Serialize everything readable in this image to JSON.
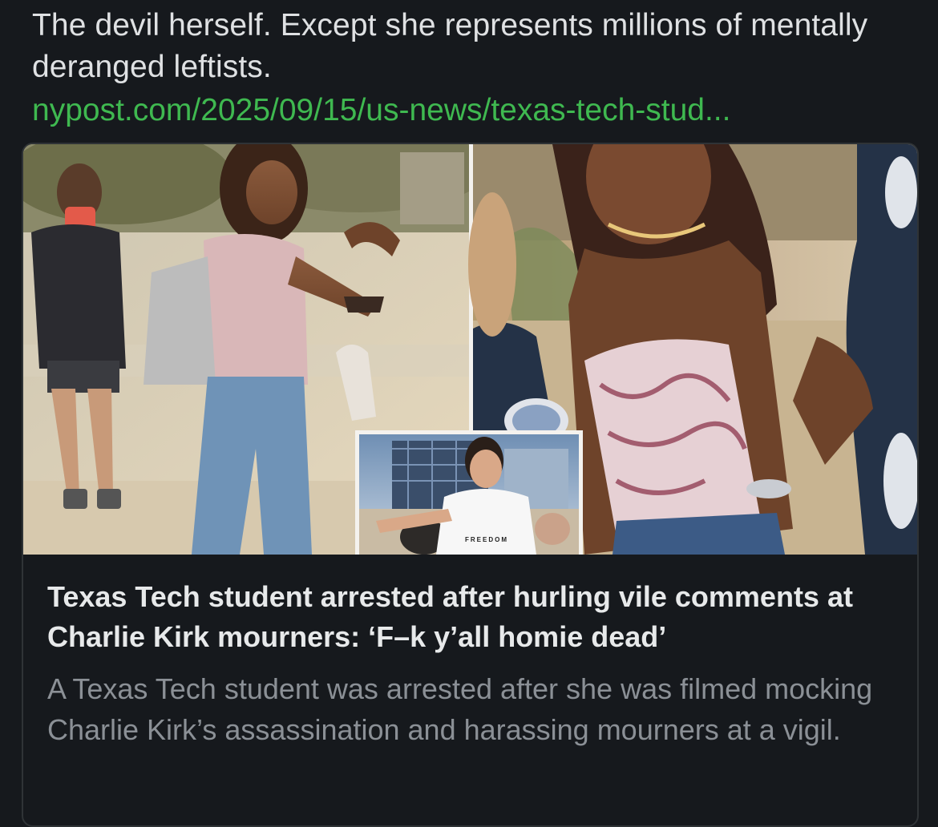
{
  "post": {
    "text": "The devil herself. Except she represents millions of mentally deranged leftists.",
    "link_text": "nypost.com/2025/09/15/us-news/texas-tech-stud..."
  },
  "link_card": {
    "image_caption_shirt": "FREEDOM",
    "title": "Texas Tech student arrested after hurling vile comments at Charlie Kirk mourners: ‘F–k y’all homie dead’",
    "description": "A Texas Tech student was arrested after she was filmed mocking Charlie Kirk’s assassination and harassing mourners at a vigil."
  },
  "colors": {
    "background": "#16191d",
    "link": "#3fb950",
    "title": "#e7e9ea",
    "description": "#8b9096",
    "card_border": "#2f3336"
  }
}
